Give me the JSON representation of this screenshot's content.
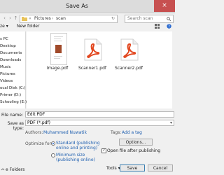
{
  "window": {
    "title": "Save As",
    "close_icon": "×"
  },
  "addressbar": {
    "back_icon": "‹",
    "forward_icon": "›",
    "up_icon": "↑",
    "separator": "«",
    "path": [
      "Pictures",
      "scan"
    ],
    "search_placeholder": "Search scan"
  },
  "toolbar": {
    "organize": "ze ▾",
    "new_folder": "New folder"
  },
  "sidebar": {
    "items": [
      "s PC",
      "Desktop",
      "Documents",
      "Downloads",
      "Music",
      "Pictures",
      "Videos",
      "ocal Disk (C:)",
      "Primer (D:)",
      "Schooling (E:)"
    ]
  },
  "files": [
    {
      "name": "Image.pdf",
      "icon": "document-thumbnail"
    },
    {
      "name": "Scanner1.pdf",
      "icon": "pdf-icon"
    },
    {
      "name": "Scanner2.pdf",
      "icon": "pdf-icon"
    }
  ],
  "form": {
    "file_name_label": "File name:",
    "file_name_value": "Edit PDF",
    "save_type_label": "Save as type:",
    "save_type_value": "PDF (*.pdf)",
    "authors_label": "Authors:",
    "authors_value": "Muhammed Nuwatik",
    "tags_label": "Tags:",
    "tags_value": "Add a tag",
    "optimize_label": "Optimize for:",
    "opt_standard": "Standard (publishing online and printing)",
    "opt_standard_line1": "Standard (publishing",
    "opt_standard_line2": "online and printing)",
    "opt_minimum_line1": "Minimum size",
    "opt_minimum_line2": "(publishing online)",
    "options_button": "Options...",
    "open_after_label": "Open file after publishing",
    "open_after_checked": true
  },
  "footer": {
    "hide_folders": "e Folders",
    "tools": "Tools ▾",
    "save": "Save",
    "cancel": "Cancel"
  },
  "colors": {
    "accent": "#2a6ad0",
    "pdf_red": "#e2471f",
    "close_red": "#c75050",
    "link_blue": "#2060b0"
  }
}
